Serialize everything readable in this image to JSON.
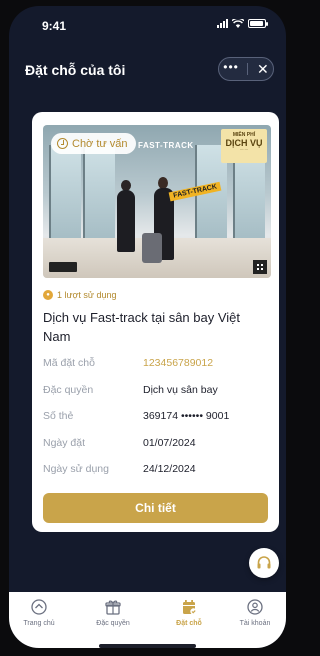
{
  "status_bar": {
    "time": "9:41"
  },
  "header": {
    "title": "Đặt chỗ của tôi",
    "more_label": "•••",
    "close_label": "✕"
  },
  "booking": {
    "banner": {
      "chip": "Chờ tư vấn",
      "fast_track": "FAST-TRACK",
      "promo_line1": "MIỄN PHÍ",
      "promo_line2": "DỊCH VỤ",
      "sign_text": "FAST-TRACK"
    },
    "usage": "1 lượt sử dụng",
    "title": "Dịch vụ Fast-track tại sân bay Việt Nam",
    "details": [
      {
        "label": "Mã đặt chỗ",
        "value": "123456789012"
      },
      {
        "label": "Đặc quyền",
        "value": "Dịch vụ sân bay"
      },
      {
        "label": "Số thẻ",
        "value": "369174 •••••• 9001"
      },
      {
        "label": "Ngày đặt",
        "value": "01/07/2024"
      },
      {
        "label": "Ngày sử dụng",
        "value": "24/12/2024"
      }
    ],
    "detail_button": "Chi tiết"
  },
  "tabs": [
    {
      "label": "Trang chủ",
      "icon": "home-icon"
    },
    {
      "label": "Đặc quyền",
      "icon": "gift-icon"
    },
    {
      "label": "Đặt chỗ",
      "icon": "calendar-check-icon",
      "active": true
    },
    {
      "label": "Tài khoản",
      "icon": "user-icon"
    }
  ],
  "colors": {
    "accent": "#c9a44a",
    "background": "#141a2c"
  }
}
